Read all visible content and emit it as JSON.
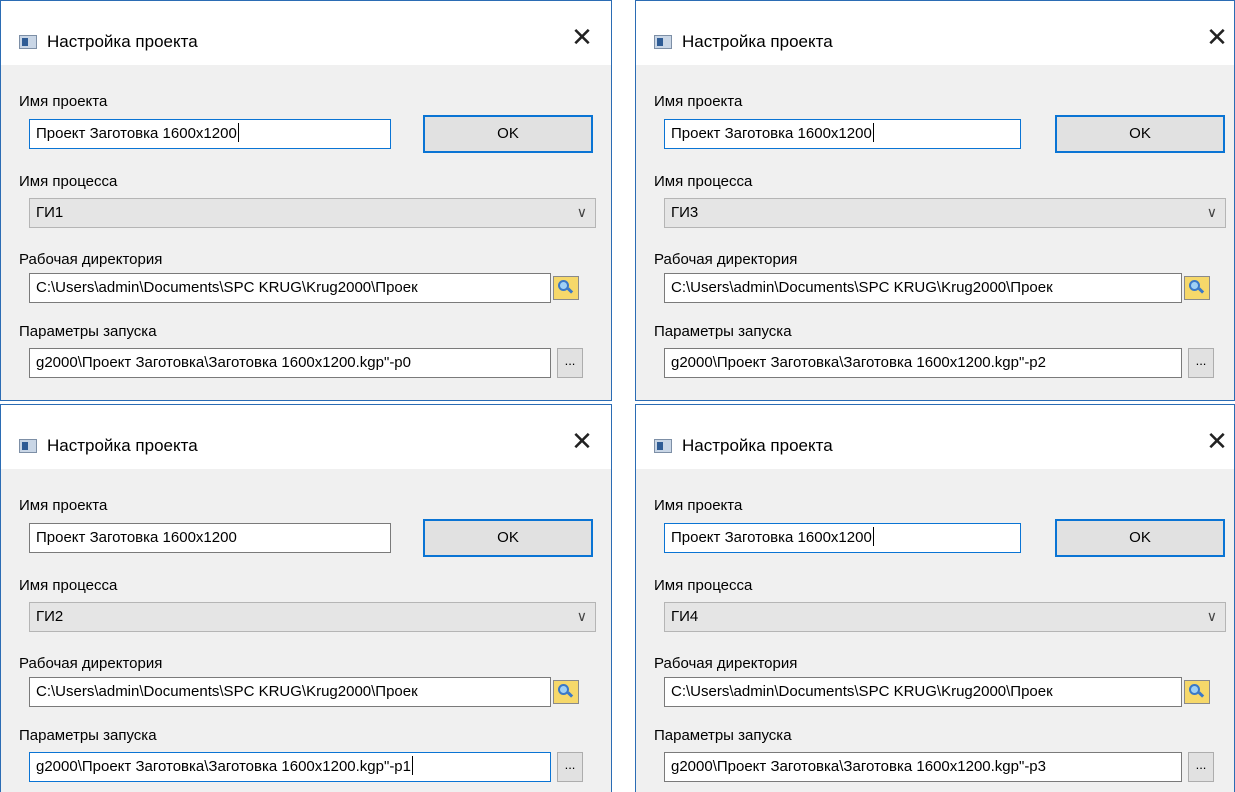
{
  "dialogs": [
    {
      "title": "Настройка проекта",
      "project_label": "Имя проекта",
      "project_value": "Проект Заготовка 1600x1200",
      "ok_label": "OK",
      "process_label": "Имя процесса",
      "process_value": "ГИ1",
      "workdir_label": "Рабочая директория",
      "workdir_value": "C:\\Users\\admin\\Documents\\SPC KRUG\\Krug2000\\Проек",
      "params_label": "Параметры запуска",
      "params_value": "g2000\\Проект Заготовка\\Заготовка 1600x1200.kgp\"-p0",
      "params_button": "..."
    },
    {
      "title": "Настройка проекта",
      "project_label": "Имя проекта",
      "project_value": "Проект Заготовка 1600x1200",
      "ok_label": "OK",
      "process_label": "Имя процесса",
      "process_value": "ГИ3",
      "workdir_label": "Рабочая директория",
      "workdir_value": "C:\\Users\\admin\\Documents\\SPC KRUG\\Krug2000\\Проек",
      "params_label": "Параметры запуска",
      "params_value": "g2000\\Проект Заготовка\\Заготовка 1600x1200.kgp\"-p2",
      "params_button": "..."
    },
    {
      "title": "Настройка проекта",
      "project_label": "Имя проекта",
      "project_value": "Проект Заготовка 1600x1200",
      "ok_label": "OK",
      "process_label": "Имя процесса",
      "process_value": "ГИ2",
      "workdir_label": "Рабочая директория",
      "workdir_value": "C:\\Users\\admin\\Documents\\SPC KRUG\\Krug2000\\Проек",
      "params_label": "Параметры запуска",
      "params_value": "g2000\\Проект Заготовка\\Заготовка 1600x1200.kgp\"-p1",
      "params_button": "..."
    },
    {
      "title": "Настройка проекта",
      "project_label": "Имя проекта",
      "project_value": "Проект Заготовка 1600x1200",
      "ok_label": "OK",
      "process_label": "Имя процесса",
      "process_value": "ГИ4",
      "workdir_label": "Рабочая директория",
      "workdir_value": "C:\\Users\\admin\\Documents\\SPC KRUG\\Krug2000\\Проек",
      "params_label": "Параметры запуска",
      "params_value": "g2000\\Проект Заготовка\\Заготовка 1600x1200.kgp\"-p3",
      "params_button": "..."
    }
  ]
}
